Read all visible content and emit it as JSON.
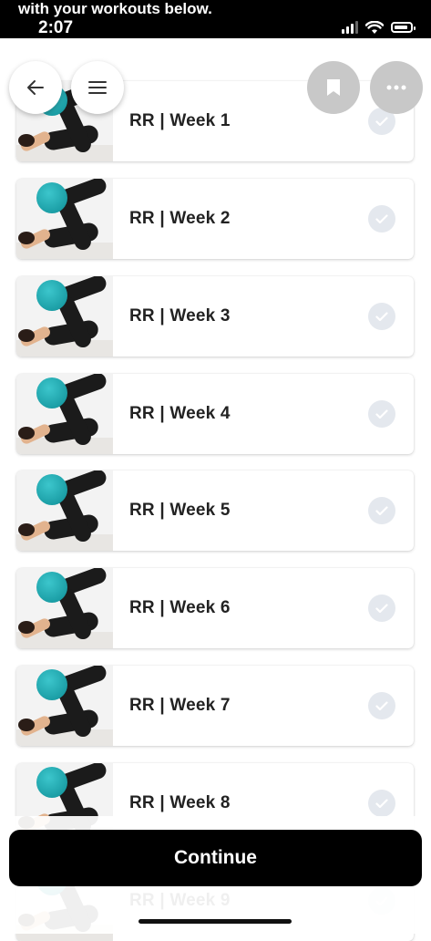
{
  "status_bar": {
    "banner_text": "with your workouts below.",
    "time": "2:07",
    "signal_icon": "signal-icon",
    "wifi_icon": "wifi-icon",
    "battery_icon": "battery-icon"
  },
  "nav": {
    "back_icon": "arrow-left-icon",
    "menu_icon": "hamburger-menu-icon",
    "bookmark_icon": "bookmark-icon",
    "more_icon": "ellipsis-icon"
  },
  "workouts": [
    {
      "title": "RR | Week 1"
    },
    {
      "title": "RR | Week 2"
    },
    {
      "title": "RR | Week 3"
    },
    {
      "title": "RR | Week 4"
    },
    {
      "title": "RR | Week 5"
    },
    {
      "title": "RR | Week 6"
    },
    {
      "title": "RR | Week 7"
    },
    {
      "title": "RR | Week 8"
    },
    {
      "title": "RR | Week 9"
    }
  ],
  "footer": {
    "continue_label": "Continue"
  },
  "colors": {
    "check_bg": "#e4e8ee",
    "check_mark": "#ffffff",
    "primary_button": "#000000",
    "ball": "#1aa9b0"
  }
}
